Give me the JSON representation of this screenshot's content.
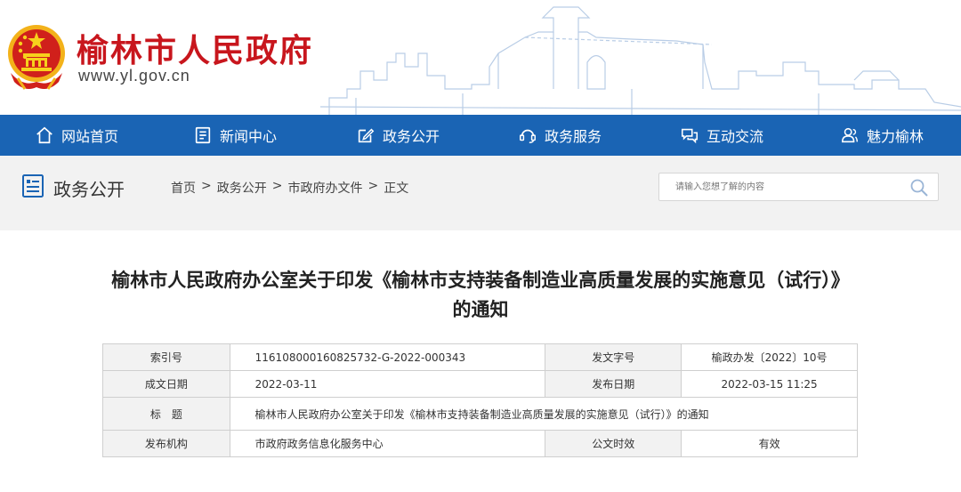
{
  "header": {
    "title": "榆林市人民政府",
    "url": "www.yl.gov.cn",
    "emblem_icon": "national-emblem-icon",
    "brand_color": "#c8161d"
  },
  "nav": {
    "background": "#1a64b4",
    "items": [
      {
        "label": "网站首页",
        "icon": "home-icon"
      },
      {
        "label": "新闻中心",
        "icon": "news-icon"
      },
      {
        "label": "政务公开",
        "icon": "edit-icon"
      },
      {
        "label": "政务服务",
        "icon": "service-icon"
      },
      {
        "label": "互动交流",
        "icon": "chat-icon"
      },
      {
        "label": "魅力榆林",
        "icon": "people-icon"
      }
    ]
  },
  "section": {
    "title": "政务公开",
    "breadcrumb": [
      "首页",
      "政务公开",
      "市政府办文件",
      "正文"
    ],
    "breadcrumb_separator": ">",
    "search_placeholder": "请输入您想了解的内容"
  },
  "document": {
    "title_line1": "榆林市人民政府办公室关于印发《榆林市支持装备制造业高质量发展的实施意见（试行）》",
    "title_line2": "的通知",
    "meta": {
      "index_label": "索引号",
      "index_value": "116108000160825732-G-2022-000343",
      "doc_no_label": "发文字号",
      "doc_no_value": "榆政办发〔2022〕10号",
      "created_label": "成文日期",
      "created_value": "2022-03-11",
      "published_label": "发布日期",
      "published_value": "2022-03-15 11:25",
      "subject_label": "标　题",
      "subject_value": "榆林市人民政府办公室关于印发《榆林市支持装备制造业高质量发展的实施意见（试行）》的通知",
      "publisher_label": "发布机构",
      "publisher_value": "市政府政务信息化服务中心",
      "validity_label": "公文时效",
      "validity_value": "有效"
    }
  }
}
